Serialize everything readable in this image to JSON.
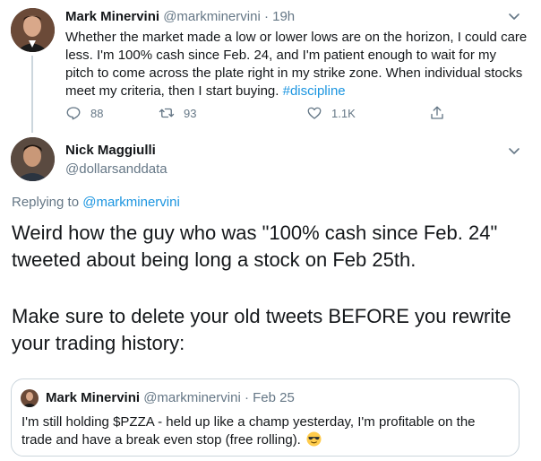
{
  "tweet1": {
    "name": "Mark Minervini",
    "handle": "@markminervini",
    "dot": "·",
    "time": "19h",
    "body_text": "Whether the market made a low or lower lows are on the horizon, I could care less. I'm 100% cash since Feb. 24, and I'm patient enough to wait for my pitch to come across the plate right in my strike zone. When individual stocks meet my criteria, then I start buying.",
    "hashtag": "#discipline",
    "actions": {
      "reply_count": "88",
      "retweet_count": "93",
      "like_count": "1.1K"
    }
  },
  "tweet2": {
    "name": "Nick Maggiulli",
    "handle": "@dollarsanddata",
    "replying_prefix": "Replying to",
    "replying_to": "@markminervini",
    "paragraph1": "Weird how the guy who was \"100% cash since Feb. 24\" tweeted about being long a stock on Feb 25th.",
    "paragraph2": "Make sure to delete your old tweets BEFORE you rewrite your trading history:"
  },
  "quoted": {
    "name": "Mark Minervini",
    "handle": "@markminervini",
    "dot": "·",
    "time": "Feb 25",
    "body_text": "I'm still holding $PZZA - held up like a champ yesterday, I'm profitable on the trade and have a break even stop (free rolling).",
    "emoji_icon": "sunglasses-emoji-icon"
  },
  "colors": {
    "link": "#1b95e0",
    "secondary_text": "#657786",
    "border": "#ccd6dd"
  }
}
